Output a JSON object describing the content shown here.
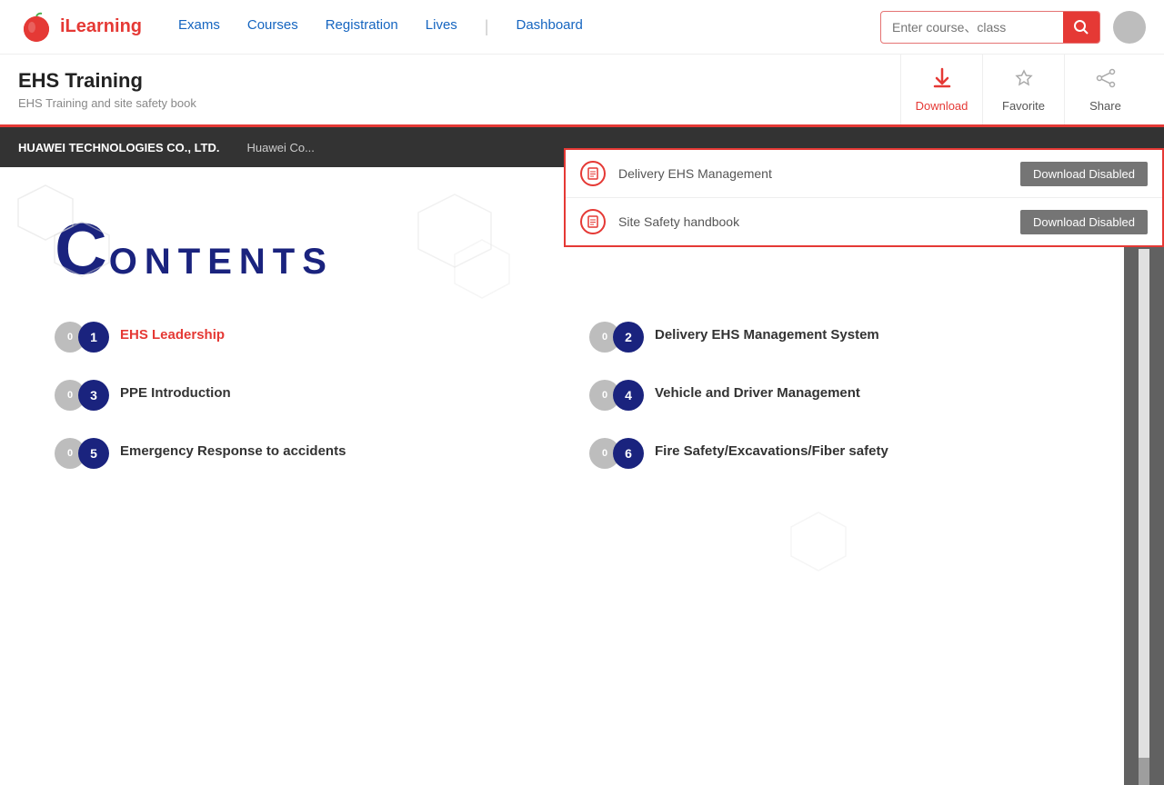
{
  "header": {
    "logo_text": "iLearning",
    "nav": {
      "exams": "Exams",
      "courses": "Courses",
      "registration": "Registration",
      "lives": "Lives",
      "dashboard": "Dashboard"
    },
    "search_placeholder": "Enter course、class"
  },
  "toolbar": {
    "page_title": "EHS Training",
    "page_subtitle": "EHS Training and site safety book",
    "download_label": "Download",
    "favorite_label": "Favorite",
    "share_label": "Share"
  },
  "company_bar": {
    "company_name": "HUAWEI TECHNOLOGIES CO., LTD.",
    "company_sub": "Huawei Co..."
  },
  "download_dropdown": {
    "items": [
      {
        "label": "Delivery EHS Management",
        "btn_label": "Download Disabled"
      },
      {
        "label": "Site Safety handbook",
        "btn_label": "Download Disabled"
      }
    ]
  },
  "book_page": {
    "contents_C": "C",
    "contents_rest": "ONTENTS",
    "items": [
      {
        "num": "01",
        "label": "EHS Leadership",
        "highlight": true
      },
      {
        "num": "02",
        "label": "Delivery EHS Management System",
        "highlight": false
      },
      {
        "num": "03",
        "label": "PPE Introduction",
        "highlight": false
      },
      {
        "num": "04",
        "label": "Vehicle and Driver Management",
        "highlight": false
      },
      {
        "num": "05",
        "label": "Emergency Response to accidents",
        "highlight": false
      },
      {
        "num": "06",
        "label": "Fire Safety/Excavations/Fiber safety",
        "highlight": false
      }
    ]
  }
}
